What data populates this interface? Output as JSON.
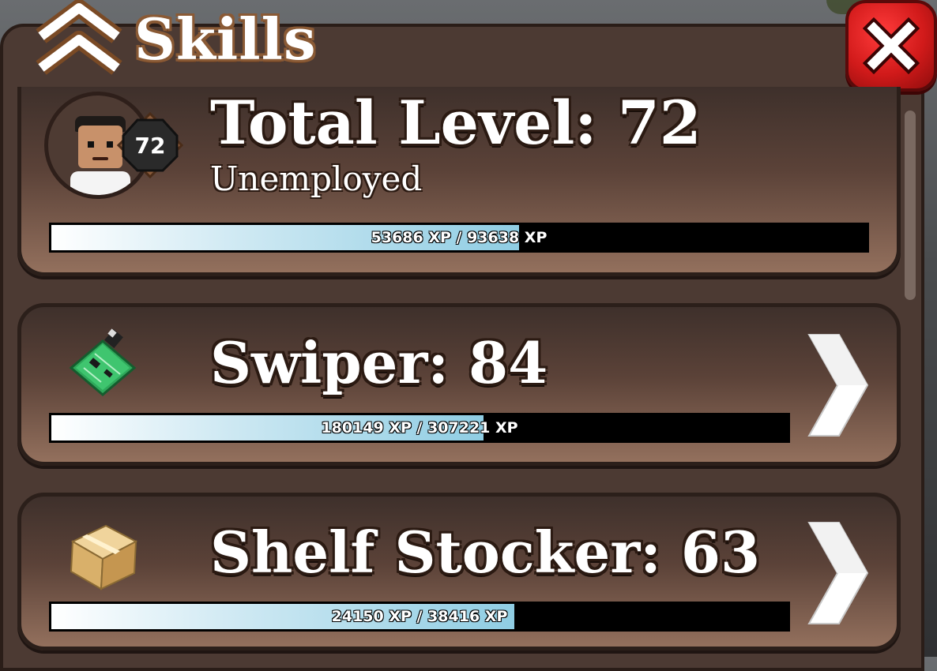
{
  "header": {
    "title": "Skills"
  },
  "total": {
    "title": "Total Level: 72",
    "level_badge": "72",
    "job": "Unemployed",
    "xp_text": "53686 XP / 93638 XP",
    "xp_current": 53686,
    "xp_max": 93638
  },
  "skills": [
    {
      "title": "Swiper: 84",
      "icon": "circuit-board-icon",
      "xp_text": "180149 XP / 307221 XP",
      "xp_current": 180149,
      "xp_max": 307221
    },
    {
      "title": "Shelf Stocker: 63",
      "icon": "cardboard-box-icon",
      "xp_text": "24150 XP / 38416 XP",
      "xp_current": 24150,
      "xp_max": 38416
    }
  ],
  "colors": {
    "panel": "#4c3a33",
    "close_button": "#d11a1a",
    "xp_fill": "#8fcde3"
  }
}
